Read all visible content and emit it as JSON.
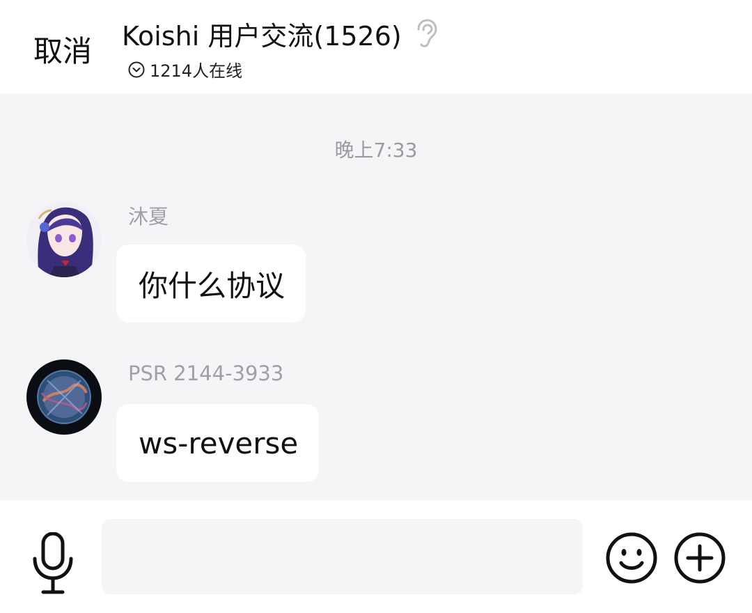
{
  "header": {
    "cancel_label": "取消",
    "title": "Koishi 用户交流(1526)",
    "online_text": "1214人在线",
    "ear_icon": "ear-icon",
    "online_icon": "chevron-down-circle-icon"
  },
  "chat": {
    "timestamp": "晚上7:33",
    "messages": [
      {
        "sender": "沐夏",
        "text": "你什么协议",
        "avatar": "anime-girl-avatar"
      },
      {
        "sender": "PSR 2144-3933",
        "text": "ws-reverse",
        "avatar": "cosmic-sphere-avatar"
      }
    ]
  },
  "input_bar": {
    "value": "",
    "placeholder": "",
    "icons": [
      "microphone-icon",
      "emoji-icon",
      "plus-icon"
    ]
  },
  "colors": {
    "chat_background": "#f5f4f7",
    "bubble": "#ffffff",
    "secondary_text": "#9a9a9f"
  }
}
